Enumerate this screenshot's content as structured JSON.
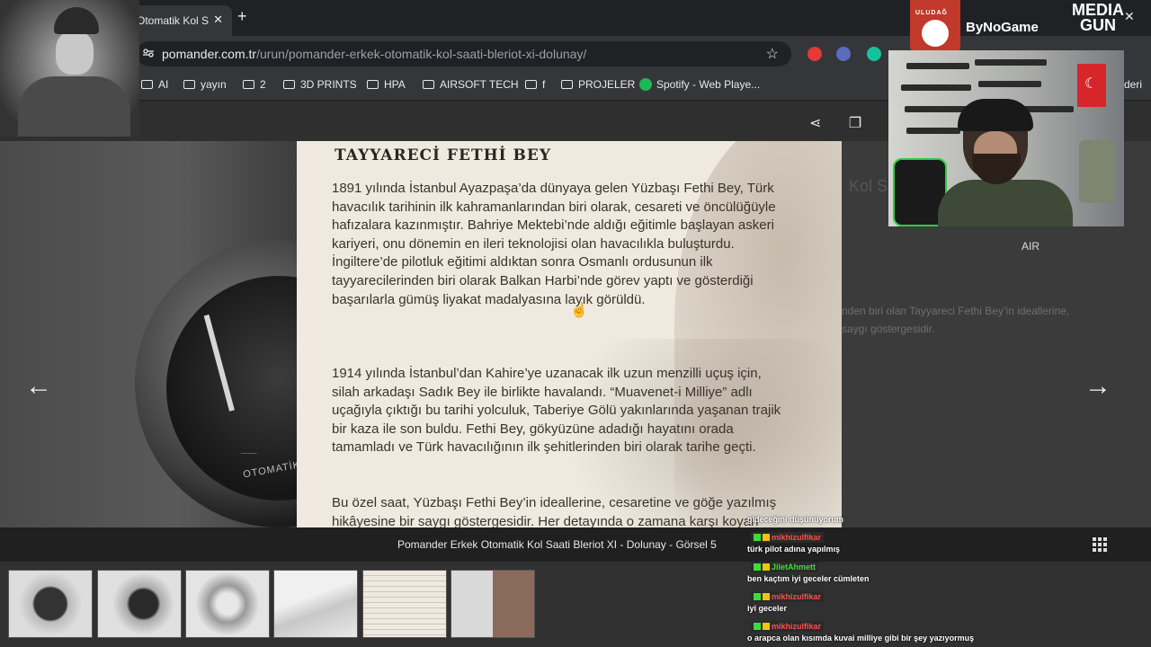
{
  "browser": {
    "tab_title": "Otomatik Kol S",
    "tab_close": "✕",
    "new_tab": "+",
    "url_host": "pomander.com.tr",
    "url_path": "/urun/pomander-erkek-otomatik-kol-saati-bleriot-xi-dolunay/",
    "star": "☆",
    "window_close": "✕",
    "bookmarks": [
      "AI",
      "yayın",
      "2",
      "3D PRINTS",
      "HPA",
      "AIRSOFT TECH",
      "f",
      "PROJELER"
    ],
    "spotify_bookmark": "Spotify - Web Playe...",
    "bookmarks_right_fragment": "deri"
  },
  "document": {
    "title": "TAYYARECİ FETHİ BEY",
    "paragraph1": "1891 yılında İstanbul Ayazpaşa’da dünyaya gelen Yüzbaşı Fethi Bey, Türk havacılık tarihinin ilk kahramanlarından biri olarak, cesareti ve öncülüğüyle hafızalara kazınmıştır. Bahriye Mektebi’nde aldığı eğitimle başlayan askeri kariyeri, onu dönemin en ileri teknolojisi olan havacılıkla buluşturdu. İngiltere’de pilotluk eğitimi aldıktan sonra Osmanlı ordusunun ilk tayyarecilerinden biri olarak Balkan Harbi’nde görev yaptı ve gösterdiği başarılarla gümüş liyakat madalyasına layık görüldü.",
    "paragraph2": "1914 yılında İstanbul’dan Kahire’ye uzanacak ilk uzun menzilli uçuş için, silah arkadaşı Sadık Bey ile birlikte havalandı. “Muavenet-i Milliye” adlı uçağıyla çıktığı bu tarihi yolculuk, Taberiye Gölü yakınlarında yaşanan trajik bir kaza ile son buldu. Fethi Bey, gökyüzüne adadığı hayatını orada tamamladı ve Türk havacılığının ilk şehitlerinden biri olarak tarihe geçti.",
    "paragraph3": "Bu özel saat, Yüzbaşı Fethi Bey’in ideallerine, cesaretine ve göğe yazılmış hikâyesine bir saygı göstergesidir. Her detayında o zamana karşı koyan ruhu, akla geleni dizayn tasarlandı ve geçmişin uzanan hayalleri saklıdır."
  },
  "page": {
    "product_title_fragment": "Kol S",
    "right_text_line1": "nden biri olan Tayyareci Fethi Bey’in ideallerine,",
    "right_text_line2": "saygı göstergesidir.",
    "watch_label": "OTOMATİK",
    "caption": "Pomander Erkek Otomatik Kol Saati Bleriot XI - Dolunay - Görsel 5",
    "prev_arrow": "←",
    "next_arrow": "→",
    "share_icon": "⋖",
    "copy_icon": "❐"
  },
  "overlay": {
    "uludag_text": "ULUDAĞ",
    "bynogame": "ByNoGame",
    "media_gun": "MEDIA GUN",
    "air_label": "AIR"
  },
  "chat": [
    {
      "type": "message",
      "text": "gideceğini düşünüyorum"
    },
    {
      "type": "user",
      "name": "mikhizulfikar",
      "color": "#ff4d4d"
    },
    {
      "type": "message",
      "text": "türk pilot adına yapılmış"
    },
    {
      "type": "user",
      "name": "JiletAhmett",
      "color": "#3ddc3d"
    },
    {
      "type": "message",
      "text": "ben kaçtım iyi geceler cümleten"
    },
    {
      "type": "user",
      "name": "mikhizulfikar",
      "color": "#ff4d4d"
    },
    {
      "type": "message",
      "text": "iyi geceler"
    },
    {
      "type": "user",
      "name": "mikhizulfikar",
      "color": "#ff4d4d"
    },
    {
      "type": "message",
      "text": "o arapca olan kısımda kuvai milliye gibi bir şey yazıyormuş"
    }
  ],
  "colors": {
    "accent_chat_red": "#ff4d4d",
    "accent_chat_green": "#3ddc3d",
    "spotify_green": "#1db954"
  }
}
